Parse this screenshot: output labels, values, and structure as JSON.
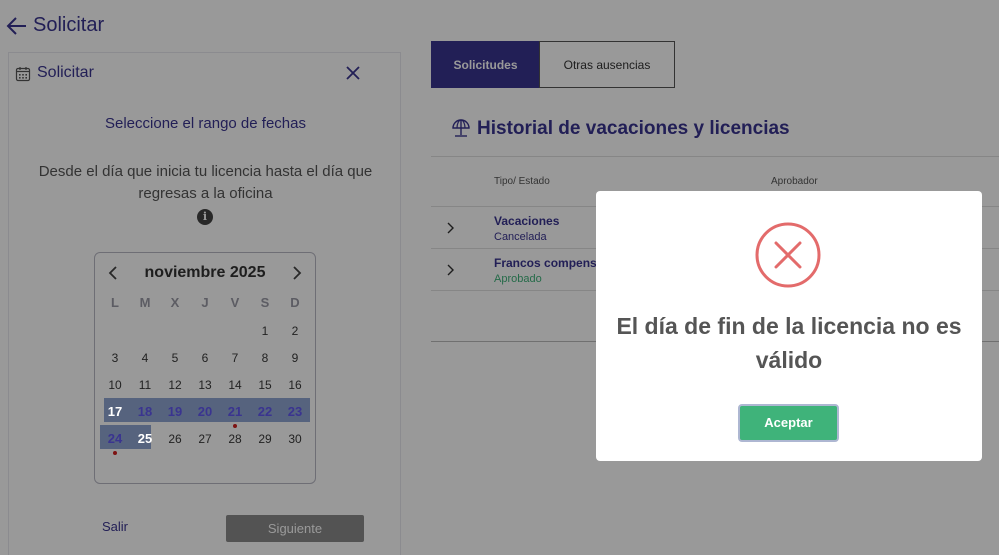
{
  "header": {
    "title": "Solicitar",
    "back_icon": "arrow-left-icon"
  },
  "request_panel": {
    "title": "Solicitar",
    "subtitle": "Seleccione el rango de fechas",
    "description": "Desde el día que inicia tu licencia hasta el día que regresas a la oficina",
    "info_icon": "i",
    "calendar": {
      "month_label": "noviembre 2025",
      "weekdays": [
        "L",
        "M",
        "X",
        "J",
        "V",
        "S",
        "D"
      ],
      "weeks": [
        [
          "",
          "",
          "",
          "",
          "",
          "1",
          "2"
        ],
        [
          "3",
          "4",
          "5",
          "6",
          "7",
          "8",
          "9"
        ],
        [
          "10",
          "11",
          "12",
          "13",
          "14",
          "15",
          "16"
        ],
        [
          "17",
          "18",
          "19",
          "20",
          "21",
          "22",
          "23"
        ],
        [
          "24",
          "25",
          "26",
          "27",
          "28",
          "29",
          "30"
        ]
      ],
      "range_start": "17",
      "range_end": "25",
      "marked_days": [
        "21",
        "24"
      ]
    },
    "exit_label": "Salir",
    "next_label": "Siguiente"
  },
  "tabs": [
    {
      "label": "Solicitudes",
      "active": true
    },
    {
      "label": "Otras ausencias",
      "active": false
    }
  ],
  "history": {
    "title": "Historial de vacaciones y licencias",
    "columns": {
      "type_status": "Tipo/ Estado",
      "approver": "Aprobador"
    },
    "rows": [
      {
        "type": "Vacaciones",
        "status": "Cancelada",
        "status_color": "#3a3490"
      },
      {
        "type": "Francos compensatorios",
        "status": "Aprobado",
        "status_color": "#3fb37a"
      }
    ]
  },
  "modal": {
    "icon": "error-x-icon",
    "message": "El día de fin de la licencia no es válido",
    "accept_label": "Aceptar"
  },
  "colors": {
    "brand": "#3a3490",
    "range": "#8fa6d3",
    "success": "#3fb37a",
    "error": "#e36b6b"
  }
}
